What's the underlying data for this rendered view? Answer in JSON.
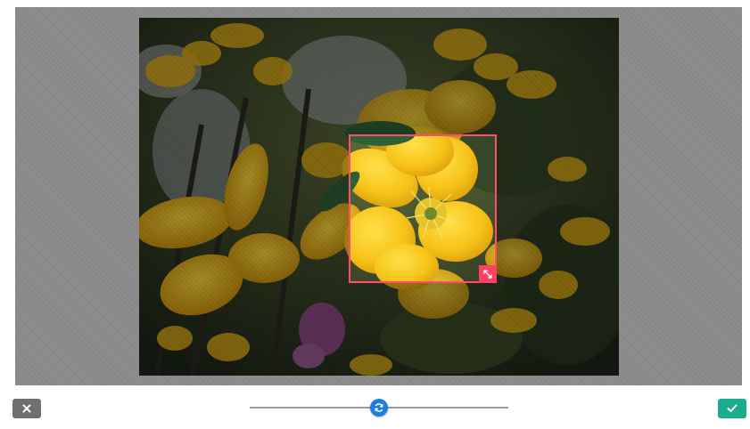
{
  "editor": {
    "image": {
      "subject": "yellow flowers"
    },
    "zoom": {
      "level": 0.5
    }
  },
  "toolbar": {
    "cancel": {
      "icon": "close-icon"
    },
    "confirm": {
      "icon": "check-icon"
    }
  },
  "colors": {
    "crop_border": "#ff4d6d",
    "resize_handle": "#ff3f63",
    "slider_thumb": "#1f7de0",
    "confirm_button": "#1bab8f",
    "cancel_button": "#6f6f6f"
  }
}
